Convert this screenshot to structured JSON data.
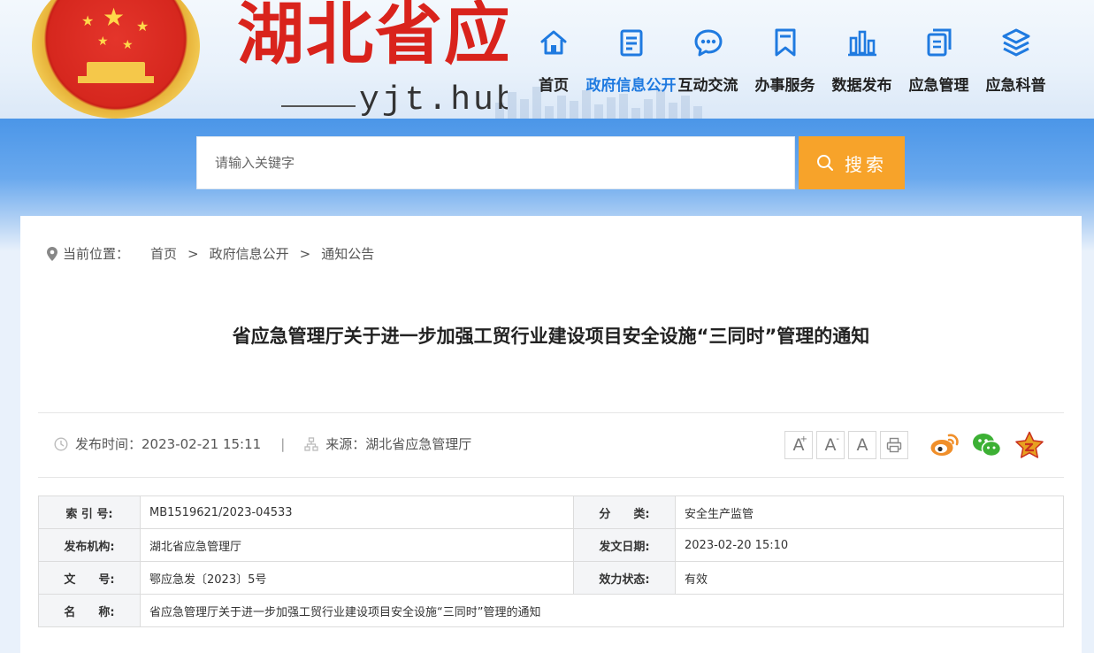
{
  "header": {
    "site_title": "湖北省应",
    "domain": "yjt.hubei"
  },
  "nav": [
    {
      "label": "首页",
      "icon": "home-icon"
    },
    {
      "label": "政府信息公开",
      "icon": "document-icon",
      "active": true
    },
    {
      "label": "互动交流",
      "icon": "chat-icon"
    },
    {
      "label": "办事服务",
      "icon": "bookmark-icon"
    },
    {
      "label": "数据发布",
      "icon": "bar-chart-icon"
    },
    {
      "label": "应急管理",
      "icon": "docs-icon"
    },
    {
      "label": "应急科普",
      "icon": "layers-icon"
    }
  ],
  "search": {
    "placeholder": "请输入关键字",
    "button_label": "搜索"
  },
  "breadcrumb": {
    "label": "当前位置：",
    "items": [
      "首页",
      "政府信息公开",
      "通知公告"
    ],
    "separator": ">"
  },
  "article": {
    "title": "省应急管理厅关于进一步加强工贸行业建设项目安全设施“三同时”管理的通知",
    "publish_label": "发布时间：",
    "publish_time": "2023-02-21 15:11",
    "meta_separator": "|",
    "source_label": "来源：",
    "source": "湖北省应急管理厅"
  },
  "tools": {
    "font_larger": "A",
    "font_smaller": "A",
    "font_reset": "A",
    "plus_mark": "+",
    "minus_mark": "-"
  },
  "info": {
    "index_label": "索 引 号:",
    "index_value": "MB1519621/2023-04533",
    "category_label": "分　　类:",
    "category_value": "安全生产监管",
    "issuer_label": "发布机构:",
    "issuer_value": "湖北省应急管理厅",
    "issue_date_label": "发文日期:",
    "issue_date_value": "2023-02-20 15:10",
    "doc_no_label": "文　　号:",
    "doc_no_value": "鄂应急发〔2023〕5号",
    "status_label": "效力状态:",
    "status_value": "有效",
    "name_label": "名　　称:",
    "name_value": "省应急管理厅关于进一步加强工贸行业建设项目安全设施“三同时”管理的通知"
  },
  "colors": {
    "accent_blue": "#1f7ae0",
    "search_orange": "#f7a32a",
    "title_red": "#d9231c",
    "weibo": "#f08f2a",
    "wechat": "#3cb034",
    "favorite": "#e8a020"
  }
}
